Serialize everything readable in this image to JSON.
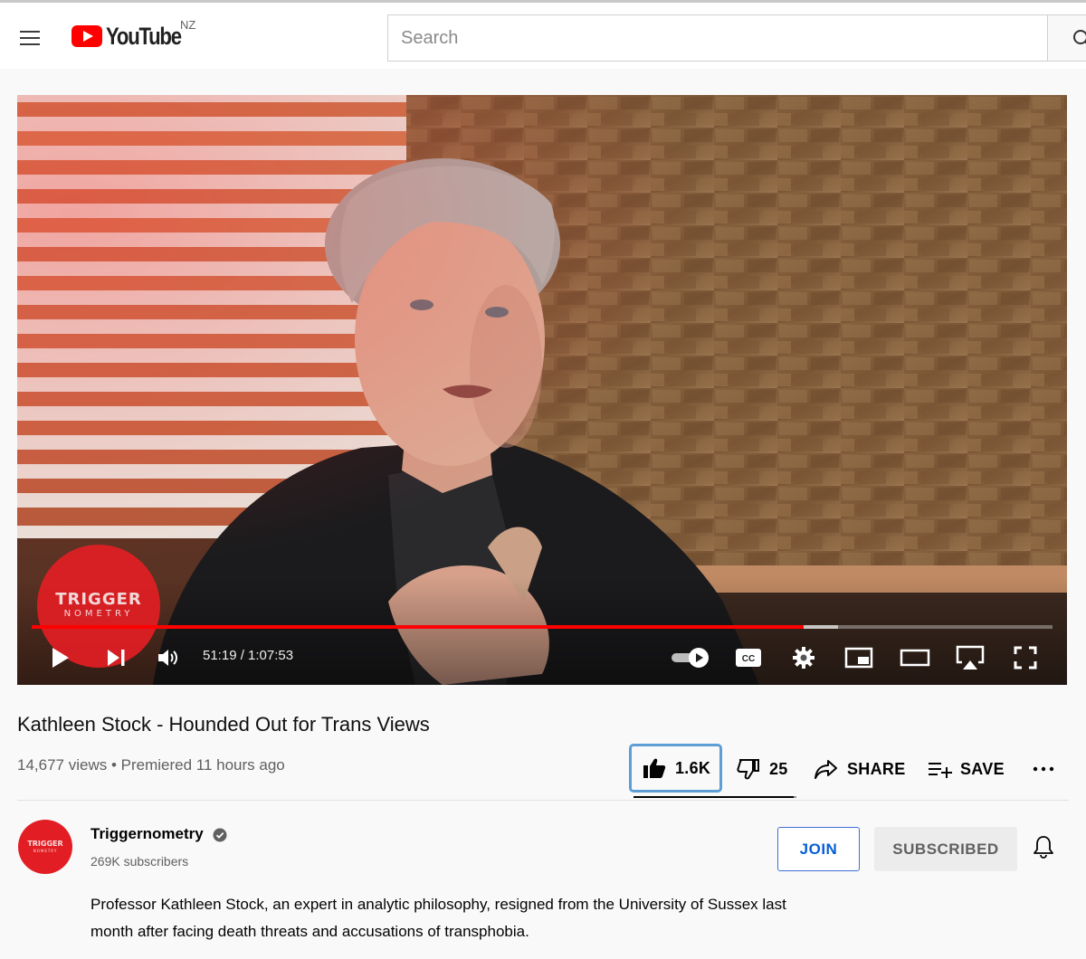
{
  "header": {
    "logo_text": "YouTube",
    "country_code": "NZ",
    "search_placeholder": "Search"
  },
  "player": {
    "watermark_line1": "TRIGGER",
    "watermark_line2": "NOMETRY",
    "current_time": "51:19",
    "duration": "1:07:53",
    "time_display": "51:19 / 1:07:53",
    "played_fraction": 0.756,
    "loaded_fraction": 0.79,
    "autoplay_on": true,
    "accent_color": "#ff0000"
  },
  "video": {
    "title": "Kathleen Stock - Hounded Out for Trans Views",
    "meta": "14,677 views • Premiered 11 hours ago",
    "likes": "1.6K",
    "dislikes": "25",
    "share_label": "SHARE",
    "save_label": "SAVE",
    "like_ratio": 0.985
  },
  "channel": {
    "name": "Triggernometry",
    "subscribers": "269K subscribers",
    "avatar_line1": "TRIGGER",
    "avatar_line2": "NOMETRY",
    "join_label": "JOIN",
    "subscribed_label": "SUBSCRIBED",
    "brand_color": "#e21e24"
  },
  "description": "Professor Kathleen Stock, an expert in analytic philosophy, resigned from the University of Sussex last month after facing death threats and accusations of transphobia."
}
